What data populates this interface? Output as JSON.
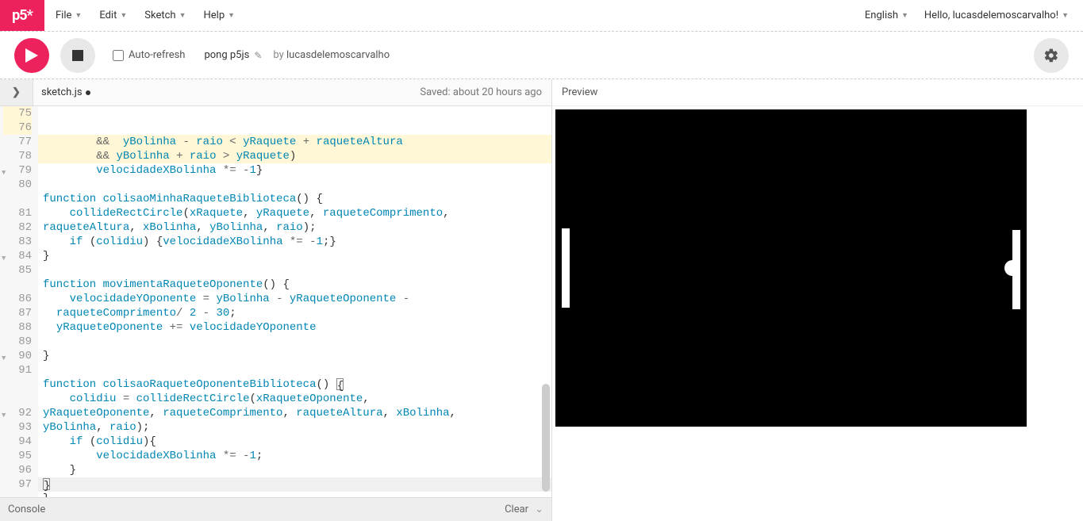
{
  "logo": "p5*",
  "menu": {
    "file": "File",
    "edit": "Edit",
    "sketch": "Sketch",
    "help": "Help"
  },
  "menu_right": {
    "language": "English",
    "greeting": "Hello, lucasdelemoscarvalho!"
  },
  "toolbar": {
    "auto_refresh": "Auto-refresh",
    "auto_refresh_checked": false,
    "sketch_name": "pong p5js",
    "by_label": "by",
    "author": "lucasdelemoscarvalho"
  },
  "file_header": {
    "arrow": "❯",
    "filename": "sketch.js",
    "dirty": true,
    "saved_text": "Saved: about 20 hours ago"
  },
  "code": {
    "first_line": 75,
    "lines": [
      {
        "n": 75,
        "hl": true,
        "fold": null,
        "html": "        <span class='op'>&&</span>  <span class='nm'>yBolinha</span> <span class='op'>-</span> <span class='nm'>raio</span> <span class='op'>&lt;</span> <span class='nm'>yRaquete</span> <span class='op'>+</span> <span class='nm'>raqueteAltura</span>"
      },
      {
        "n": 76,
        "hl": true,
        "fold": null,
        "html": "        <span class='op'>&&</span> <span class='nm'>yBolinha</span> <span class='op'>+</span> <span class='nm'>raio</span> <span class='op'>&gt;</span> <span class='nm'>yRaquete</span><span class='pn'>)</span>"
      },
      {
        "n": 77,
        "hl": false,
        "fold": null,
        "html": "        <span class='nm'>velocidadeXBolinha</span> <span class='op'>*=</span> <span class='op'>-</span><span class='num'>1</span><span class='pn'>}</span>"
      },
      {
        "n": 78,
        "hl": false,
        "fold": null,
        "html": ""
      },
      {
        "n": 79,
        "hl": false,
        "fold": "▼",
        "html": "<span class='kw'>function</span> <span class='fn'>colisaoMinhaRaqueteBiblioteca</span><span class='pn'>()</span> <span class='pn'>{</span>"
      },
      {
        "n": 80,
        "hl": false,
        "fold": null,
        "html": "    <span class='fn'>collideRectCircle</span><span class='pn'>(</span><span class='nm'>xRaquete</span><span class='pn'>,</span> <span class='nm'>yRaquete</span><span class='pn'>,</span> <span class='nm'>raqueteComprimento</span><span class='pn'>,</span>"
      },
      {
        "n": null,
        "hl": false,
        "fold": null,
        "html": "<span class='nm'>raqueteAltura</span><span class='pn'>,</span> <span class='nm'>xBolinha</span><span class='pn'>,</span> <span class='nm'>yBolinha</span><span class='pn'>,</span> <span class='nm'>raio</span><span class='pn'>);</span>"
      },
      {
        "n": 81,
        "hl": false,
        "fold": null,
        "html": "    <span class='kw'>if</span> <span class='pn'>(</span><span class='nm'>colidiu</span><span class='pn'>)</span> <span class='pn'>{</span><span class='nm'>velocidadeXBolinha</span> <span class='op'>*=</span> <span class='op'>-</span><span class='num'>1</span><span class='pn'>;}</span>"
      },
      {
        "n": 82,
        "hl": false,
        "fold": null,
        "html": "<span class='pn'>}</span>"
      },
      {
        "n": 83,
        "hl": false,
        "fold": null,
        "html": ""
      },
      {
        "n": 84,
        "hl": false,
        "fold": "▼",
        "html": "<span class='kw'>function</span> <span class='fn'>movimentaRaqueteOponente</span><span class='pn'>()</span> <span class='pn'>{</span>"
      },
      {
        "n": 85,
        "hl": false,
        "fold": null,
        "html": "    <span class='nm'>velocidadeYOponente</span> <span class='op'>=</span> <span class='nm'>yBolinha</span> <span class='op'>-</span> <span class='nm'>yRaqueteOponente</span> <span class='op'>-</span>"
      },
      {
        "n": null,
        "hl": false,
        "fold": null,
        "html": "  <span class='nm'>raqueteComprimento</span><span class='op'>/</span> <span class='num'>2</span> <span class='op'>-</span> <span class='num'>30</span><span class='pn'>;</span>"
      },
      {
        "n": 86,
        "hl": false,
        "fold": null,
        "html": "  <span class='nm'>yRaqueteOponente</span> <span class='op'>+=</span> <span class='nm'>velocidadeYOponente</span>"
      },
      {
        "n": 87,
        "hl": false,
        "fold": null,
        "html": ""
      },
      {
        "n": 88,
        "hl": false,
        "fold": null,
        "html": "<span class='pn'>}</span>"
      },
      {
        "n": 89,
        "hl": false,
        "fold": null,
        "html": ""
      },
      {
        "n": 90,
        "hl": false,
        "fold": "▼",
        "html": "<span class='kw'>function</span> <span class='fn'>colisaoRaqueteOponenteBiblioteca</span><span class='pn'>()</span> <span class='pn'><span class='box-cursor'>{</span></span>"
      },
      {
        "n": 91,
        "hl": false,
        "fold": null,
        "html": "    <span class='nm'>colidiu</span> <span class='op'>=</span> <span class='fn'>collideRectCircle</span><span class='pn'>(</span><span class='nm'>xRaqueteOponente</span><span class='pn'>,</span>"
      },
      {
        "n": null,
        "hl": false,
        "fold": null,
        "html": "<span class='nm'>yRaqueteOponente</span><span class='pn'>,</span> <span class='nm'>raqueteComprimento</span><span class='pn'>,</span> <span class='nm'>raqueteAltura</span><span class='pn'>,</span> <span class='nm'>xBolinha</span><span class='pn'>,</span>"
      },
      {
        "n": null,
        "hl": false,
        "fold": null,
        "html": "<span class='nm'>yBolinha</span><span class='pn'>,</span> <span class='nm'>raio</span><span class='pn'>);</span>"
      },
      {
        "n": 92,
        "hl": false,
        "fold": "▼",
        "html": "    <span class='kw'>if</span> <span class='pn'>(</span><span class='nm'>colidiu</span><span class='pn'>){</span>"
      },
      {
        "n": 93,
        "hl": false,
        "fold": null,
        "html": "        <span class='nm'>velocidadeXBolinha</span> <span class='op'>*=</span> <span class='op'>-</span><span class='num'>1</span><span class='pn'>;</span>"
      },
      {
        "n": 94,
        "hl": false,
        "fold": null,
        "html": "    <span class='pn'>}</span>"
      },
      {
        "n": 95,
        "hl": false,
        "fold": null,
        "cur": true,
        "html": "<span class='pn'><span class='box-cursor'>}</span></span>"
      },
      {
        "n": 96,
        "hl": false,
        "fold": null,
        "html": "<span class='pn'>}</span>"
      },
      {
        "n": 97,
        "hl": false,
        "fold": null,
        "html": ""
      }
    ]
  },
  "console": {
    "label": "Console",
    "clear": "Clear"
  },
  "preview": {
    "label": "Preview"
  }
}
